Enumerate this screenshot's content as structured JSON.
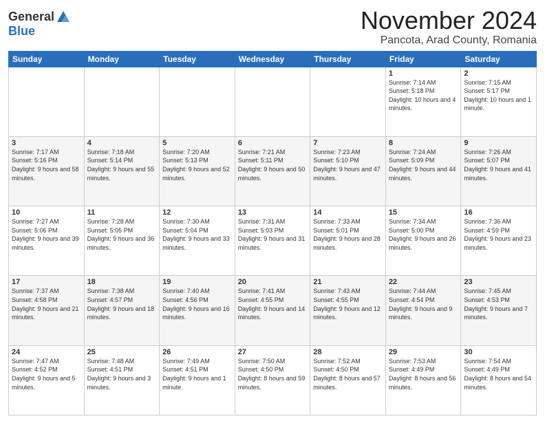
{
  "logo": {
    "general": "General",
    "blue": "Blue"
  },
  "header": {
    "month": "November 2024",
    "location": "Pancota, Arad County, Romania"
  },
  "weekdays": [
    "Sunday",
    "Monday",
    "Tuesday",
    "Wednesday",
    "Thursday",
    "Friday",
    "Saturday"
  ],
  "weeks": [
    [
      {
        "day": "",
        "info": ""
      },
      {
        "day": "",
        "info": ""
      },
      {
        "day": "",
        "info": ""
      },
      {
        "day": "",
        "info": ""
      },
      {
        "day": "",
        "info": ""
      },
      {
        "day": "1",
        "info": "Sunrise: 7:14 AM\nSunset: 5:18 PM\nDaylight: 10 hours and 4 minutes."
      },
      {
        "day": "2",
        "info": "Sunrise: 7:15 AM\nSunset: 5:17 PM\nDaylight: 10 hours and 1 minute."
      }
    ],
    [
      {
        "day": "3",
        "info": "Sunrise: 7:17 AM\nSunset: 5:16 PM\nDaylight: 9 hours and 58 minutes."
      },
      {
        "day": "4",
        "info": "Sunrise: 7:18 AM\nSunset: 5:14 PM\nDaylight: 9 hours and 55 minutes."
      },
      {
        "day": "5",
        "info": "Sunrise: 7:20 AM\nSunset: 5:13 PM\nDaylight: 9 hours and 52 minutes."
      },
      {
        "day": "6",
        "info": "Sunrise: 7:21 AM\nSunset: 5:11 PM\nDaylight: 9 hours and 50 minutes."
      },
      {
        "day": "7",
        "info": "Sunrise: 7:23 AM\nSunset: 5:10 PM\nDaylight: 9 hours and 47 minutes."
      },
      {
        "day": "8",
        "info": "Sunrise: 7:24 AM\nSunset: 5:09 PM\nDaylight: 9 hours and 44 minutes."
      },
      {
        "day": "9",
        "info": "Sunrise: 7:26 AM\nSunset: 5:07 PM\nDaylight: 9 hours and 41 minutes."
      }
    ],
    [
      {
        "day": "10",
        "info": "Sunrise: 7:27 AM\nSunset: 5:06 PM\nDaylight: 9 hours and 39 minutes."
      },
      {
        "day": "11",
        "info": "Sunrise: 7:28 AM\nSunset: 5:05 PM\nDaylight: 9 hours and 36 minutes."
      },
      {
        "day": "12",
        "info": "Sunrise: 7:30 AM\nSunset: 5:04 PM\nDaylight: 9 hours and 33 minutes."
      },
      {
        "day": "13",
        "info": "Sunrise: 7:31 AM\nSunset: 5:03 PM\nDaylight: 9 hours and 31 minutes."
      },
      {
        "day": "14",
        "info": "Sunrise: 7:33 AM\nSunset: 5:01 PM\nDaylight: 9 hours and 28 minutes."
      },
      {
        "day": "15",
        "info": "Sunrise: 7:34 AM\nSunset: 5:00 PM\nDaylight: 9 hours and 26 minutes."
      },
      {
        "day": "16",
        "info": "Sunrise: 7:36 AM\nSunset: 4:59 PM\nDaylight: 9 hours and 23 minutes."
      }
    ],
    [
      {
        "day": "17",
        "info": "Sunrise: 7:37 AM\nSunset: 4:58 PM\nDaylight: 9 hours and 21 minutes."
      },
      {
        "day": "18",
        "info": "Sunrise: 7:38 AM\nSunset: 4:57 PM\nDaylight: 9 hours and 18 minutes."
      },
      {
        "day": "19",
        "info": "Sunrise: 7:40 AM\nSunset: 4:56 PM\nDaylight: 9 hours and 16 minutes."
      },
      {
        "day": "20",
        "info": "Sunrise: 7:41 AM\nSunset: 4:55 PM\nDaylight: 9 hours and 14 minutes."
      },
      {
        "day": "21",
        "info": "Sunrise: 7:43 AM\nSunset: 4:55 PM\nDaylight: 9 hours and 12 minutes."
      },
      {
        "day": "22",
        "info": "Sunrise: 7:44 AM\nSunset: 4:54 PM\nDaylight: 9 hours and 9 minutes."
      },
      {
        "day": "23",
        "info": "Sunrise: 7:45 AM\nSunset: 4:53 PM\nDaylight: 9 hours and 7 minutes."
      }
    ],
    [
      {
        "day": "24",
        "info": "Sunrise: 7:47 AM\nSunset: 4:52 PM\nDaylight: 9 hours and 5 minutes."
      },
      {
        "day": "25",
        "info": "Sunrise: 7:48 AM\nSunset: 4:51 PM\nDaylight: 9 hours and 3 minutes."
      },
      {
        "day": "26",
        "info": "Sunrise: 7:49 AM\nSunset: 4:51 PM\nDaylight: 9 hours and 1 minute."
      },
      {
        "day": "27",
        "info": "Sunrise: 7:50 AM\nSunset: 4:50 PM\nDaylight: 8 hours and 59 minutes."
      },
      {
        "day": "28",
        "info": "Sunrise: 7:52 AM\nSunset: 4:50 PM\nDaylight: 8 hours and 57 minutes."
      },
      {
        "day": "29",
        "info": "Sunrise: 7:53 AM\nSunset: 4:49 PM\nDaylight: 8 hours and 56 minutes."
      },
      {
        "day": "30",
        "info": "Sunrise: 7:54 AM\nSunset: 4:49 PM\nDaylight: 8 hours and 54 minutes."
      }
    ]
  ]
}
